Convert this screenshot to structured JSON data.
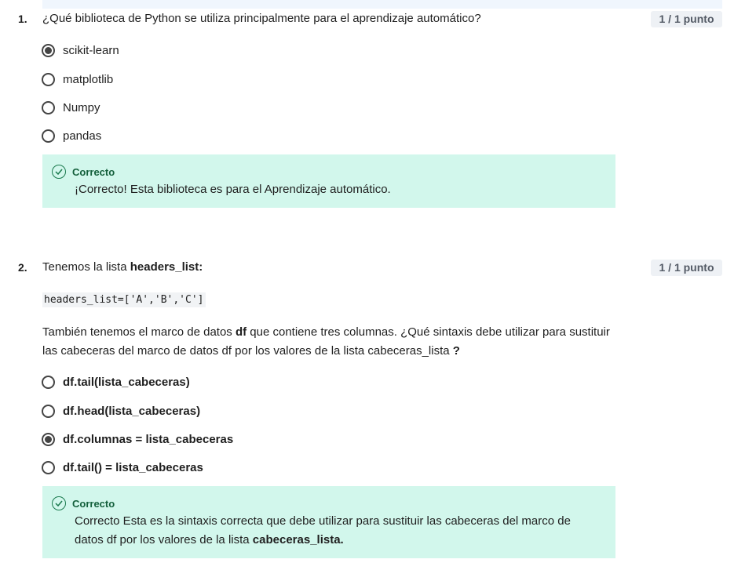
{
  "q1": {
    "number": "1.",
    "question": "¿Qué biblioteca de Python se utiliza principalmente para el aprendizaje automático?",
    "score": "1 / 1 punto",
    "options": [
      {
        "label": "scikit-learn",
        "selected": true
      },
      {
        "label": "matplotlib",
        "selected": false
      },
      {
        "label": "Numpy",
        "selected": false
      },
      {
        "label": "pandas",
        "selected": false
      }
    ],
    "feedback": {
      "title": "Correcto",
      "text": "¡Correcto! Esta biblioteca es para el Aprendizaje automático."
    }
  },
  "q2": {
    "number": "2.",
    "question_prefix": "Tenemos la lista ",
    "question_bold": "headers_list:",
    "score": "1 / 1 punto",
    "code": "headers_list=['A','B','C']",
    "paragraph": {
      "part1": "También tenemos el marco de datos ",
      "bold1": "df",
      "part2": " que contiene tres columnas. ¿Qué sintaxis debe utilizar para sustituir las cabeceras del marco de datos df por los valores de la lista cabeceras_lista ",
      "bold2": "?"
    },
    "options": [
      {
        "label": "df.tail(lista_cabeceras)",
        "selected": false
      },
      {
        "label": "df.head(lista_cabeceras)",
        "selected": false
      },
      {
        "label": "df.columnas = lista_cabeceras",
        "selected": true
      },
      {
        "label": "df.tail() = lista_cabeceras",
        "selected": false
      }
    ],
    "feedback": {
      "title": "Correcto",
      "text": "Correcto Esta es la sintaxis correcta que debe utilizar para sustituir las cabeceras del marco de datos df por los valores de la lista ",
      "text_bold": "cabeceras_lista."
    }
  },
  "colors": {
    "feedback_bg": "#d2f7ec",
    "feedback_title": "#14603c",
    "score_bg": "#eef1f5"
  }
}
